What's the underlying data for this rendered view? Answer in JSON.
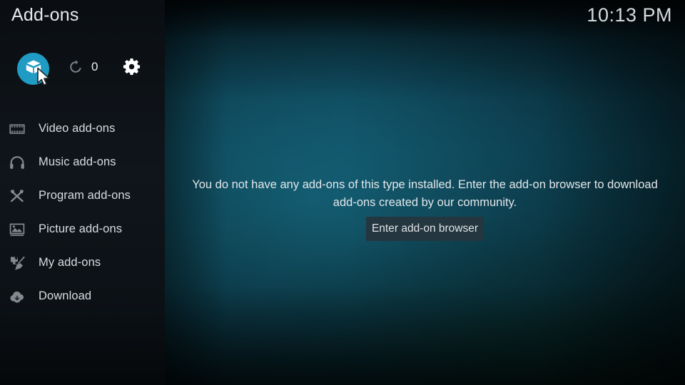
{
  "window": {
    "title": "Add-ons",
    "clock": "10:13 PM"
  },
  "toolbar": {
    "addon_icon": "package-box-icon",
    "refresh_icon": "refresh-icon",
    "refresh_count": "0",
    "settings_icon": "gear-icon"
  },
  "sidebar": {
    "items": [
      {
        "label": "Video add-ons",
        "icon": "film-strip-icon"
      },
      {
        "label": "Music add-ons",
        "icon": "headphones-icon"
      },
      {
        "label": "Program add-ons",
        "icon": "ruler-pencil-icon"
      },
      {
        "label": "Picture add-ons",
        "icon": "picture-frame-icon"
      },
      {
        "label": "My add-ons",
        "icon": "puzzle-screwdriver-icon"
      },
      {
        "label": "Download",
        "icon": "cloud-download-icon"
      }
    ]
  },
  "main": {
    "empty_message": "You do not have any add-ons of this type installed. Enter the add-on browser to download add-ons created by our community.",
    "browse_button_label": "Enter add-on browser"
  },
  "colors": {
    "accent": "#1f9bc4",
    "sidebar_bg": "#0d1116",
    "content_bg": "#10566c",
    "button_bg": "#24363f",
    "text": "#e2e7ea"
  }
}
